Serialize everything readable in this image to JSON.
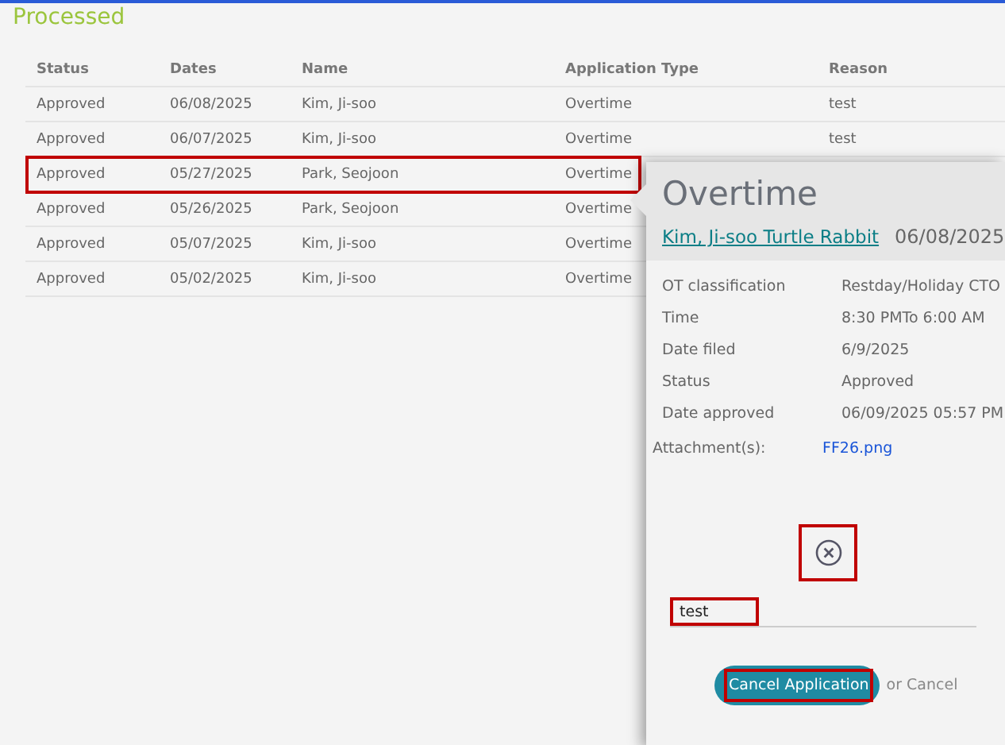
{
  "section_title": "Processed",
  "table": {
    "columns": [
      "Status",
      "Dates",
      "Name",
      "Application Type",
      "Reason"
    ],
    "rows": [
      {
        "cells": [
          "Approved",
          "06/08/2025",
          "Kim, Ji-soo",
          "Overtime",
          "test"
        ],
        "highlighted": false
      },
      {
        "cells": [
          "Approved",
          "06/07/2025",
          "Kim, Ji-soo",
          "Overtime",
          "test"
        ],
        "highlighted": false
      },
      {
        "cells": [
          "Approved",
          "05/27/2025",
          "Park, Seojoon",
          "Overtime"
        ],
        "highlighted": true
      },
      {
        "cells": [
          "Approved",
          "05/26/2025",
          "Park, Seojoon",
          "Overtime"
        ],
        "highlighted": false
      },
      {
        "cells": [
          "Approved",
          "05/07/2025",
          "Kim, Ji-soo",
          "Overtime"
        ],
        "highlighted": false
      },
      {
        "cells": [
          "Approved",
          "05/02/2025",
          "Kim, Ji-soo",
          "Overtime"
        ],
        "highlighted": false
      }
    ]
  },
  "popup": {
    "title": "Overtime",
    "employee_link": "Kim, Ji-soo Turtle Rabbit",
    "date": "06/08/2025",
    "details": [
      {
        "label": "OT classification",
        "value": "Restday/Holiday CTO"
      },
      {
        "label": "Time",
        "value": "8:30 PMTo 6:00 AM"
      },
      {
        "label": "Date filed",
        "value": "6/9/2025"
      },
      {
        "label": "Status",
        "value": "Approved"
      },
      {
        "label": "Date approved",
        "value": "06/09/2025 05:57 PM"
      }
    ],
    "attachment_label": "Attachment(s):",
    "attachment_link": "FF26.png",
    "clear_icon_highlighted": true,
    "reason_field": {
      "value": "test",
      "highlighted": true
    },
    "cancel_button": {
      "label": "Cancel Application",
      "highlighted": true
    },
    "or_cancel": "or Cancel"
  }
}
